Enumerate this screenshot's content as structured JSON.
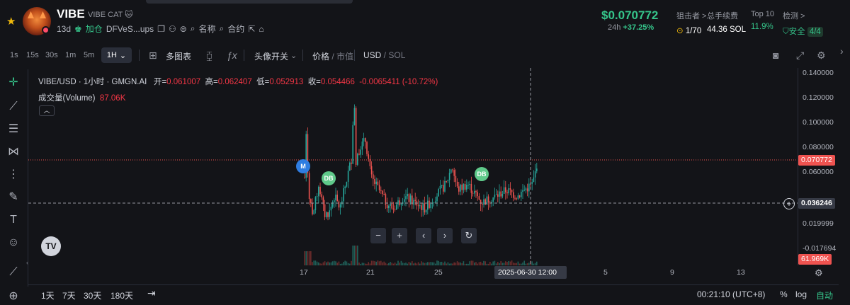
{
  "token": {
    "symbol": "VIBE",
    "name": "VIBE CAT",
    "age": "13d",
    "join_label": "加仓",
    "address": "DFVeS...ups",
    "name_label": "名称",
    "contract_label": "合约"
  },
  "stats": {
    "price": "$0.070772",
    "change_label": "24h",
    "change": "+37.25%",
    "snipers_label": "狙击者 >",
    "snipers_value": "1/70",
    "fees_label": "总手续费",
    "fees_value": "44.36 SOL",
    "top10_label": "Top 10",
    "top10_value": "11.9%",
    "check_label": "检测 >",
    "check_value": "安全",
    "check_score": "4/4"
  },
  "toolbar": {
    "timeframes": [
      "1s",
      "15s",
      "30s",
      "1m",
      "5m"
    ],
    "selected_timeframe": "1H",
    "multi_chart": "多图表",
    "avatar_toggle": "头像开关",
    "price_label": "价格",
    "mcap_label": "市值",
    "usd_label": "USD",
    "sol_label": "SOL"
  },
  "legend": {
    "pair": "VIBE/USD · 1小时 · GMGN.AI",
    "open_label": "开=",
    "open": "0.061007",
    "high_label": "高=",
    "high": "0.062407",
    "low_label": "低=",
    "low": "0.052913",
    "close_label": "收=",
    "close": "0.054466",
    "change": "-0.0065411 (-10.72%)",
    "volume_label": "成交量(Volume)",
    "volume": "87.06K"
  },
  "chart_data": {
    "type": "candlestick",
    "y_ticks": [
      "0.140000",
      "0.120000",
      "0.100000",
      "0.080000",
      "0.060000",
      "0.019999",
      "-0.017694"
    ],
    "x_ticks": [
      "17",
      "21",
      "25",
      "5",
      "9",
      "13"
    ],
    "current_price_label": "0.070772",
    "crosshair_price_label": "0.036246",
    "crosshair_time_label": "2025-06-30   12:00",
    "volume_label": "61.969K",
    "markers": [
      {
        "label": "M",
        "color": "#2f7de1"
      },
      {
        "label": "DB",
        "color": "#5fc98a"
      },
      {
        "label": "DB",
        "color": "#5fc98a"
      }
    ],
    "colors": {
      "up": "#26a69a",
      "down": "#ef5350"
    }
  },
  "bottom": {
    "ranges": [
      "1天",
      "7天",
      "30天",
      "180天"
    ],
    "clock": "00:21:10 (UTC+8)",
    "percent": "%",
    "log": "log",
    "auto": "自动"
  }
}
